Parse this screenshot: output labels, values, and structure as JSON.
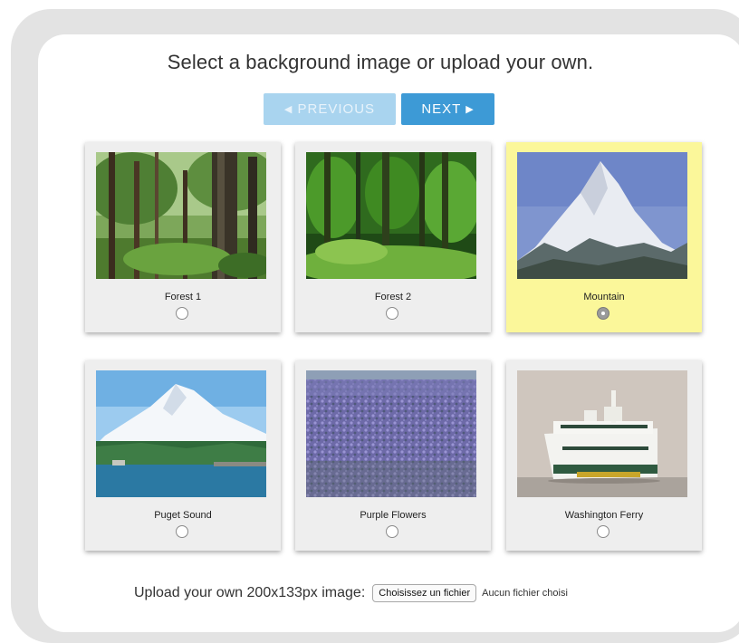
{
  "heading": "Select a background image or upload your own.",
  "nav": {
    "previous_label": "PREVIOUS",
    "next_label": "NEXT",
    "previous_icon": "◀",
    "next_icon": "▶"
  },
  "images": [
    {
      "label": "Forest 1",
      "selected": false
    },
    {
      "label": "Forest 2",
      "selected": false
    },
    {
      "label": "Mountain",
      "selected": true
    },
    {
      "label": "Puget Sound",
      "selected": false
    },
    {
      "label": "Purple Flowers",
      "selected": false
    },
    {
      "label": "Washington Ferry",
      "selected": false
    }
  ],
  "upload": {
    "label": "Upload your own 200x133px image:",
    "button_label": "Choisissez un fichier",
    "status": "Aucun fichier choisi"
  },
  "colors": {
    "selected_card": "#fbf79a",
    "next_button": "#3d9ad6",
    "previous_button_disabled": "#a9d4ef"
  }
}
